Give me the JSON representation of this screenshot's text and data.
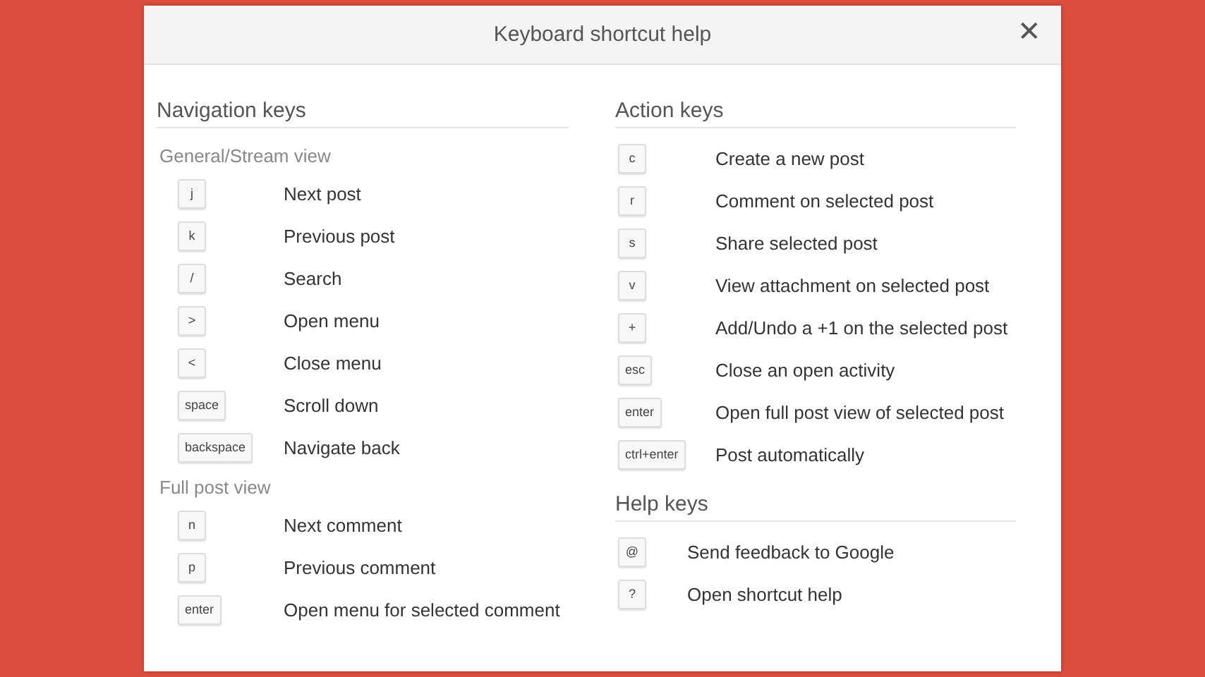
{
  "dialog": {
    "title": "Keyboard shortcut help",
    "close": "✕"
  },
  "columns": [
    {
      "sections": [
        {
          "title": "Navigation keys",
          "groups": [
            {
              "title": "General/Stream view",
              "shortcuts": [
                {
                  "key": "j",
                  "action": "Next post"
                },
                {
                  "key": "k",
                  "action": "Previous post"
                },
                {
                  "key": "/",
                  "action": "Search"
                },
                {
                  "key": ">",
                  "action": "Open menu"
                },
                {
                  "key": "<",
                  "action": "Close menu"
                },
                {
                  "key": "space",
                  "action": "Scroll down"
                },
                {
                  "key": "backspace",
                  "action": "Navigate back"
                }
              ]
            },
            {
              "title": "Full post view",
              "shortcuts": [
                {
                  "key": "n",
                  "action": "Next comment"
                },
                {
                  "key": "p",
                  "action": "Previous comment"
                },
                {
                  "key": "enter",
                  "action": "Open menu for selected comment"
                }
              ]
            }
          ]
        }
      ]
    },
    {
      "sections": [
        {
          "title": "Action keys",
          "groups": [
            {
              "shortcuts": [
                {
                  "key": "c",
                  "action": "Create a new post"
                },
                {
                  "key": "r",
                  "action": "Comment on selected post"
                },
                {
                  "key": "s",
                  "action": "Share selected post"
                },
                {
                  "key": "v",
                  "action": "View attachment on selected post"
                },
                {
                  "key": "+",
                  "action": "Add/Undo a +1 on the selected post"
                },
                {
                  "key": "esc",
                  "action": "Close an open activity"
                },
                {
                  "key": "enter",
                  "action": "Open full post view of selected post"
                },
                {
                  "key": "ctrl+enter",
                  "action": "Post automatically"
                }
              ]
            }
          ]
        },
        {
          "title": "Help keys",
          "groups": [
            {
              "shortcuts": [
                {
                  "key": "@",
                  "action": "Send feedback to Google"
                },
                {
                  "key": "?",
                  "action": "Open shortcut help"
                }
              ]
            }
          ]
        }
      ]
    }
  ]
}
